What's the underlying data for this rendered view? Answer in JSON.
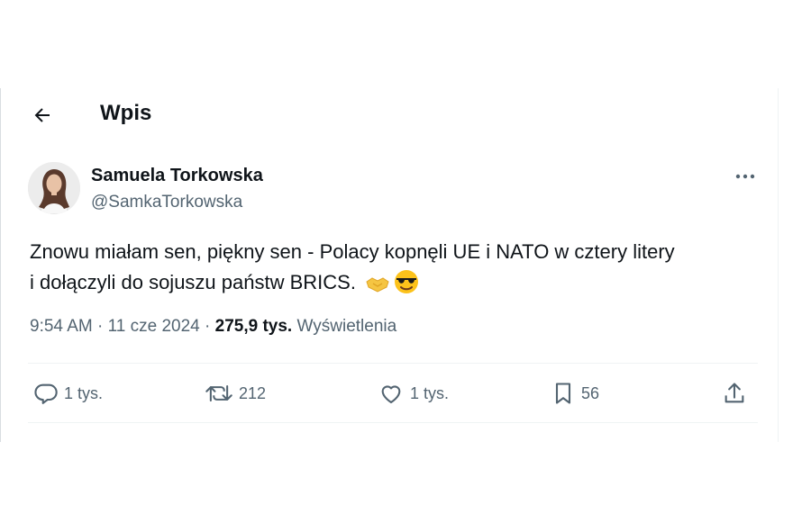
{
  "header": {
    "title": "Wpis"
  },
  "tweet": {
    "author_name": "Samuela Torkowska",
    "author_handle": "@SamkaTorkowska",
    "text_line1": "Znowu miałam sen, piękny sen - Polacy kopnęli UE i NATO w cztery litery",
    "text_line2": "i dołączyli do sojuszu państw BRICS.",
    "emojis": [
      "handshake-emoji",
      "sunglasses-emoji"
    ],
    "time": "9:54 AM",
    "date": "11 cze 2024",
    "views_count": "275,9 tys.",
    "views_label": "Wyświetlenia"
  },
  "actions": {
    "replies": "1 tys.",
    "reposts": "212",
    "likes": "1 tys.",
    "bookmarks": "56"
  },
  "colors": {
    "text": "#0f1419",
    "secondary": "#536471",
    "divider": "#eff3f4"
  }
}
